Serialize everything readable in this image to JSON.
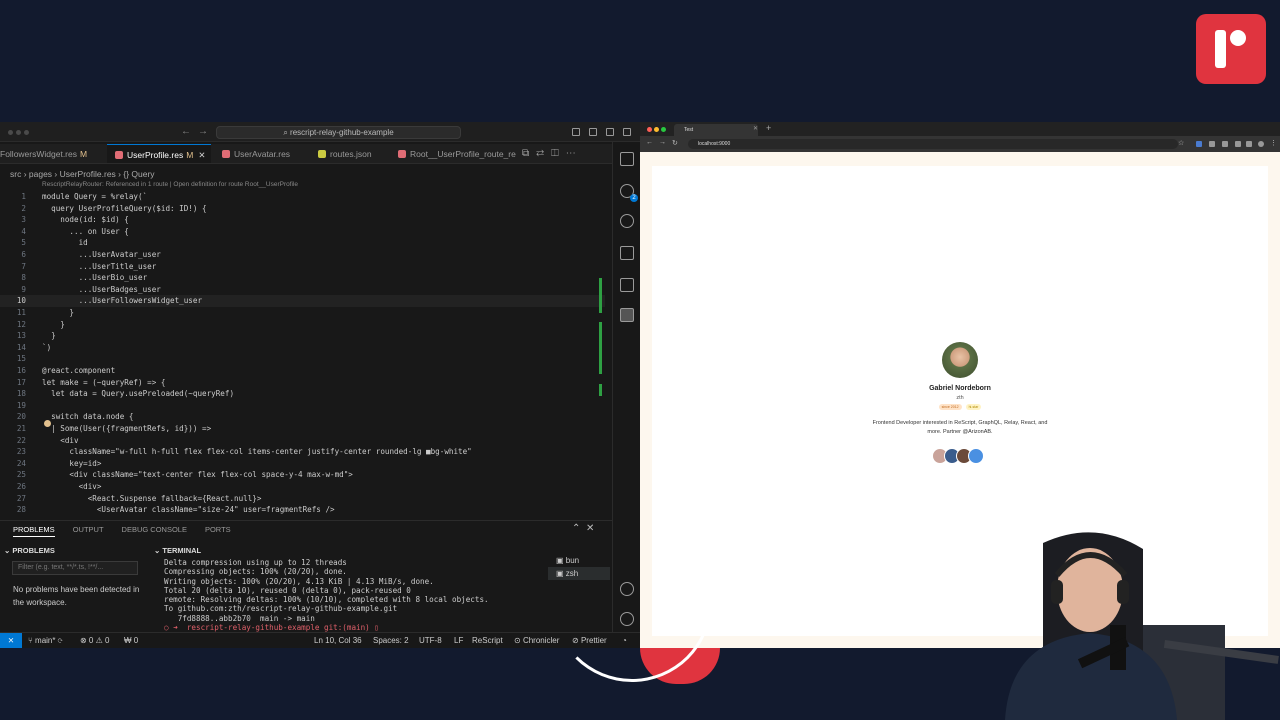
{
  "vscode": {
    "command_center": "rescript-relay-github-example",
    "tabs": [
      {
        "label": "FollowersWidget.res",
        "modified": "M",
        "color": "#e06c75",
        "active": false
      },
      {
        "label": "UserProfile.res",
        "modified": "M",
        "color": "#e06c75",
        "active": true
      },
      {
        "label": "UserAvatar.res",
        "modified": "",
        "color": "#e06c75",
        "active": false
      },
      {
        "label": "routes.json",
        "modified": "",
        "color": "#cbcb41",
        "active": false
      },
      {
        "label": "Root__UserProfile_route_re",
        "modified": "",
        "color": "#e06c75",
        "active": false
      }
    ],
    "breadcrumb": "src › pages › UserProfile.res › {} Query",
    "code_lens": "RescriptRelayRouter: Referenced in 1 route | Open definition for route Root__UserProfile",
    "code_lines": [
      "module Query = %relay(`",
      "  query UserProfileQuery($id: ID!) {",
      "    node(id: $id) {",
      "      ... on User {",
      "        id",
      "        ...UserAvatar_user",
      "        ...UserTitle_user",
      "        ...UserBio_user",
      "        ...UserBadges_user",
      "        ...UserFollowersWidget_user",
      "      }",
      "    }",
      "  }",
      "`)",
      "",
      "@react.component",
      "let make = (~queryRef) => {",
      "  let data = Query.usePreloaded(~queryRef)",
      "",
      "  switch data.node {",
      "  | Some(User({fragmentRefs, id})) =>",
      "    <div",
      "      className=\"w-full h-full flex flex-col items-center justify-center rounded-lg ■bg-white\"",
      "      key=id>",
      "      <div className=\"text-center flex flex-col space-y-4 max-w-md\">",
      "        <div>",
      "          <React.Suspense fallback={React.null}>",
      "            <UserAvatar className=\"size-24\" user=fragmentRefs />"
    ],
    "current_line": 10,
    "panel_tabs": [
      "PROBLEMS",
      "OUTPUT",
      "DEBUG CONSOLE",
      "PORTS"
    ],
    "problems_header": "PROBLEMS",
    "terminal_header": "TERMINAL",
    "filter_placeholder": "Filter (e.g. text, **/*.ts, !**/...",
    "no_problems": "No problems have been detected in the workspace.",
    "terminal_lines": [
      "Delta compression using up to 12 threads",
      "Compressing objects: 100% (20/20), done.",
      "Writing objects: 100% (20/20), 4.13 KiB | 4.13 MiB/s, done.",
      "Total 20 (delta 10), reused 0 (delta 0), pack-reused 0",
      "remote: Resolving deltas: 100% (10/10), completed with 8 local objects.",
      "To github.com:zth/rescript-relay-github-example.git",
      "   7fd8888..abb2b70  main -> main",
      "○ ➜  rescript-relay-github-example git:(main) ▯"
    ],
    "terminal_list": [
      "bun",
      "zsh"
    ],
    "status": {
      "branch": "main*",
      "errors": "⊗ 0 ⚠ 0",
      "ports": "₩ 0",
      "position": "Ln 10, Col 36",
      "spaces": "Spaces: 2",
      "encoding": "UTF-8",
      "eol": "LF",
      "language": "ReScript",
      "ext1": "Chronicler",
      "ext2": "Prettier"
    }
  },
  "browser": {
    "tab_title": "Test",
    "url": "localhost:9000",
    "profile": {
      "name": "Gabriel Nordeborn",
      "handle": "zth",
      "badges": [
        "since 2012",
        "hi-star"
      ],
      "bio": "Frontend Developer interested in ReScript, GraphQL, Relay, React, and more. Partner @ArizonAB.",
      "follower_colors": [
        "#c9a39a",
        "#3a5c8c",
        "#6b4a3a",
        "#4a90e2"
      ]
    }
  },
  "colors": {
    "accent": "#0078d4",
    "brand": "#e0343f",
    "page_bg": "#121a2e"
  }
}
